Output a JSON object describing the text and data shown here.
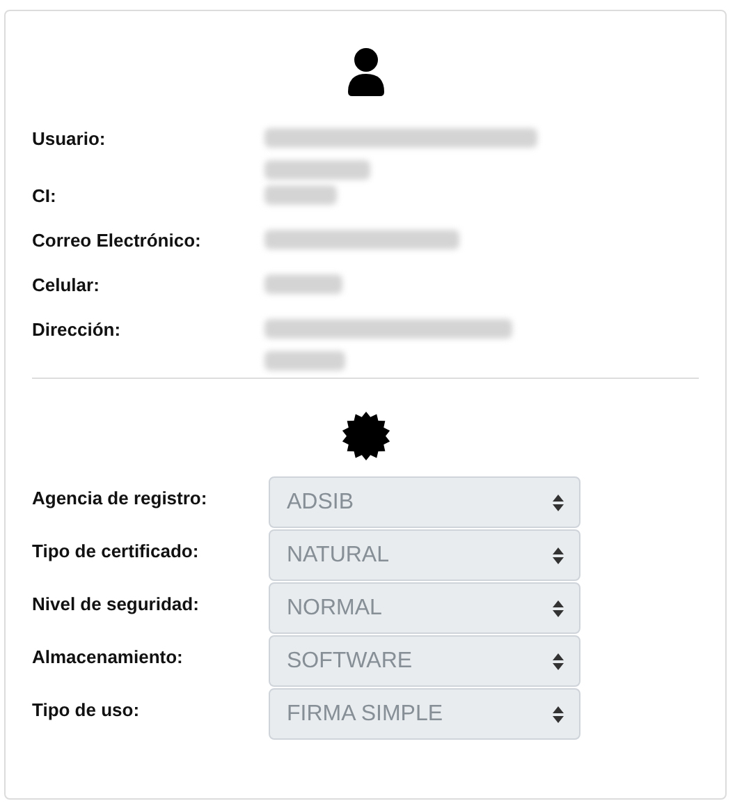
{
  "user_fields": [
    {
      "label": "Usuario:",
      "kind": "blurred"
    },
    {
      "label": "CI:",
      "kind": "blurred"
    },
    {
      "label": "Correo Electrónico:",
      "kind": "blurred"
    },
    {
      "label": "Celular:",
      "kind": "blurred"
    },
    {
      "label": "Dirección:",
      "kind": "blurred"
    }
  ],
  "certificate_fields": [
    {
      "label": "Agencia de registro:",
      "value": "ADSIB",
      "disabled": true
    },
    {
      "label": "Tipo de certificado:",
      "value": "NATURAL",
      "disabled": true
    },
    {
      "label": "Nivel de seguridad:",
      "value": "NORMAL",
      "disabled": true
    },
    {
      "label": "Almacenamiento:",
      "value": "SOFTWARE",
      "disabled": true
    },
    {
      "label": "Tipo de uso:",
      "value": "FIRMA SIMPLE",
      "disabled": true
    }
  ]
}
